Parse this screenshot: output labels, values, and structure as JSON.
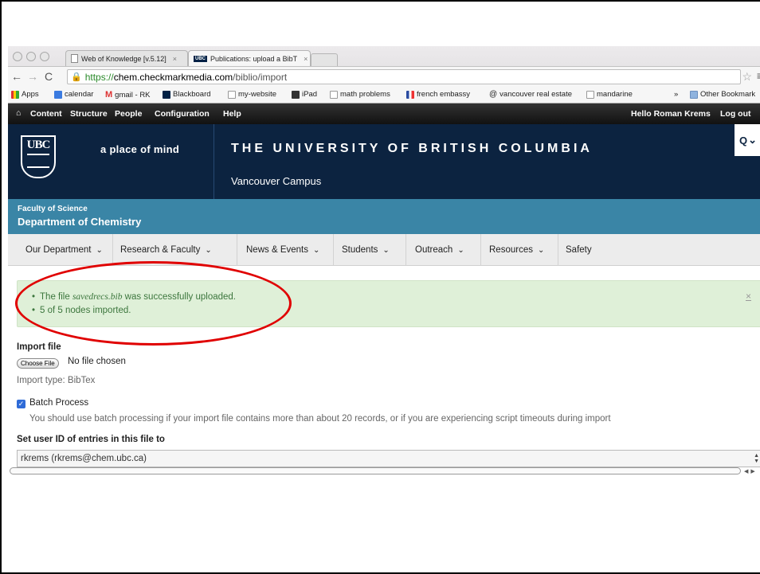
{
  "browser": {
    "tabs": [
      {
        "label": "Web of Knowledge [v.5.12]",
        "icon": "document-icon"
      },
      {
        "label": "Publications: upload a BibT",
        "icon": "ubc-icon"
      }
    ],
    "url": {
      "scheme": "https://",
      "host": "chem.checkmarkmedia.com",
      "path": "/biblio/import"
    },
    "bookmarks": [
      "Apps",
      "calendar",
      "gmail - RK",
      "Blackboard",
      "my-website",
      "iPad",
      "math problems",
      "french embassy",
      "vancouver real estate",
      "mandarine",
      "Other Bookmark"
    ],
    "bookmarks_overflow": "»"
  },
  "admin": {
    "items": [
      "Content",
      "Structure",
      "People",
      "Configuration",
      "Help"
    ],
    "hello": "Hello",
    "user": "Roman Krems",
    "logout": "Log out"
  },
  "header": {
    "logo": "UBC",
    "tagline": "a place of mind",
    "university": "THE UNIVERSITY OF BRITISH COLUMBIA",
    "campus": "Vancouver Campus",
    "search_icon": "Q",
    "search_chevron": "⌄"
  },
  "faculty": {
    "name": "Faculty of Science",
    "department": "Department of Chemistry"
  },
  "nav": {
    "items": [
      {
        "label": "Our Department",
        "dropdown": "⌄"
      },
      {
        "label": "Research & Faculty",
        "dropdown": "⌄"
      },
      {
        "label": "News & Events",
        "dropdown": "⌄"
      },
      {
        "label": "Students",
        "dropdown": "⌄"
      },
      {
        "label": "Outreach",
        "dropdown": "⌄"
      },
      {
        "label": "Resources",
        "dropdown": "⌄"
      },
      {
        "label": "Safety",
        "dropdown": ""
      }
    ]
  },
  "status": {
    "line1_prefix": "The file ",
    "line1_file": "savedrecs.bib",
    "line1_suffix": " was successfully uploaded.",
    "line2": "5 of 5 nodes imported.",
    "close": "×",
    "highlight_color": "#e00000"
  },
  "form": {
    "import_file_label": "Import file",
    "choose_file_button": "Choose File",
    "no_file_text": "No file chosen",
    "import_type": "Import type: BibTex",
    "batch_label": "Batch Process",
    "batch_checked": true,
    "batch_help": "You should use batch processing if your import file contains more than about 20 records, or if you are experiencing script timeouts during import",
    "user_id_label": "Set user ID of entries in this file to",
    "user_id_value": "rkrems (rkrems@chem.ubc.ca)"
  }
}
